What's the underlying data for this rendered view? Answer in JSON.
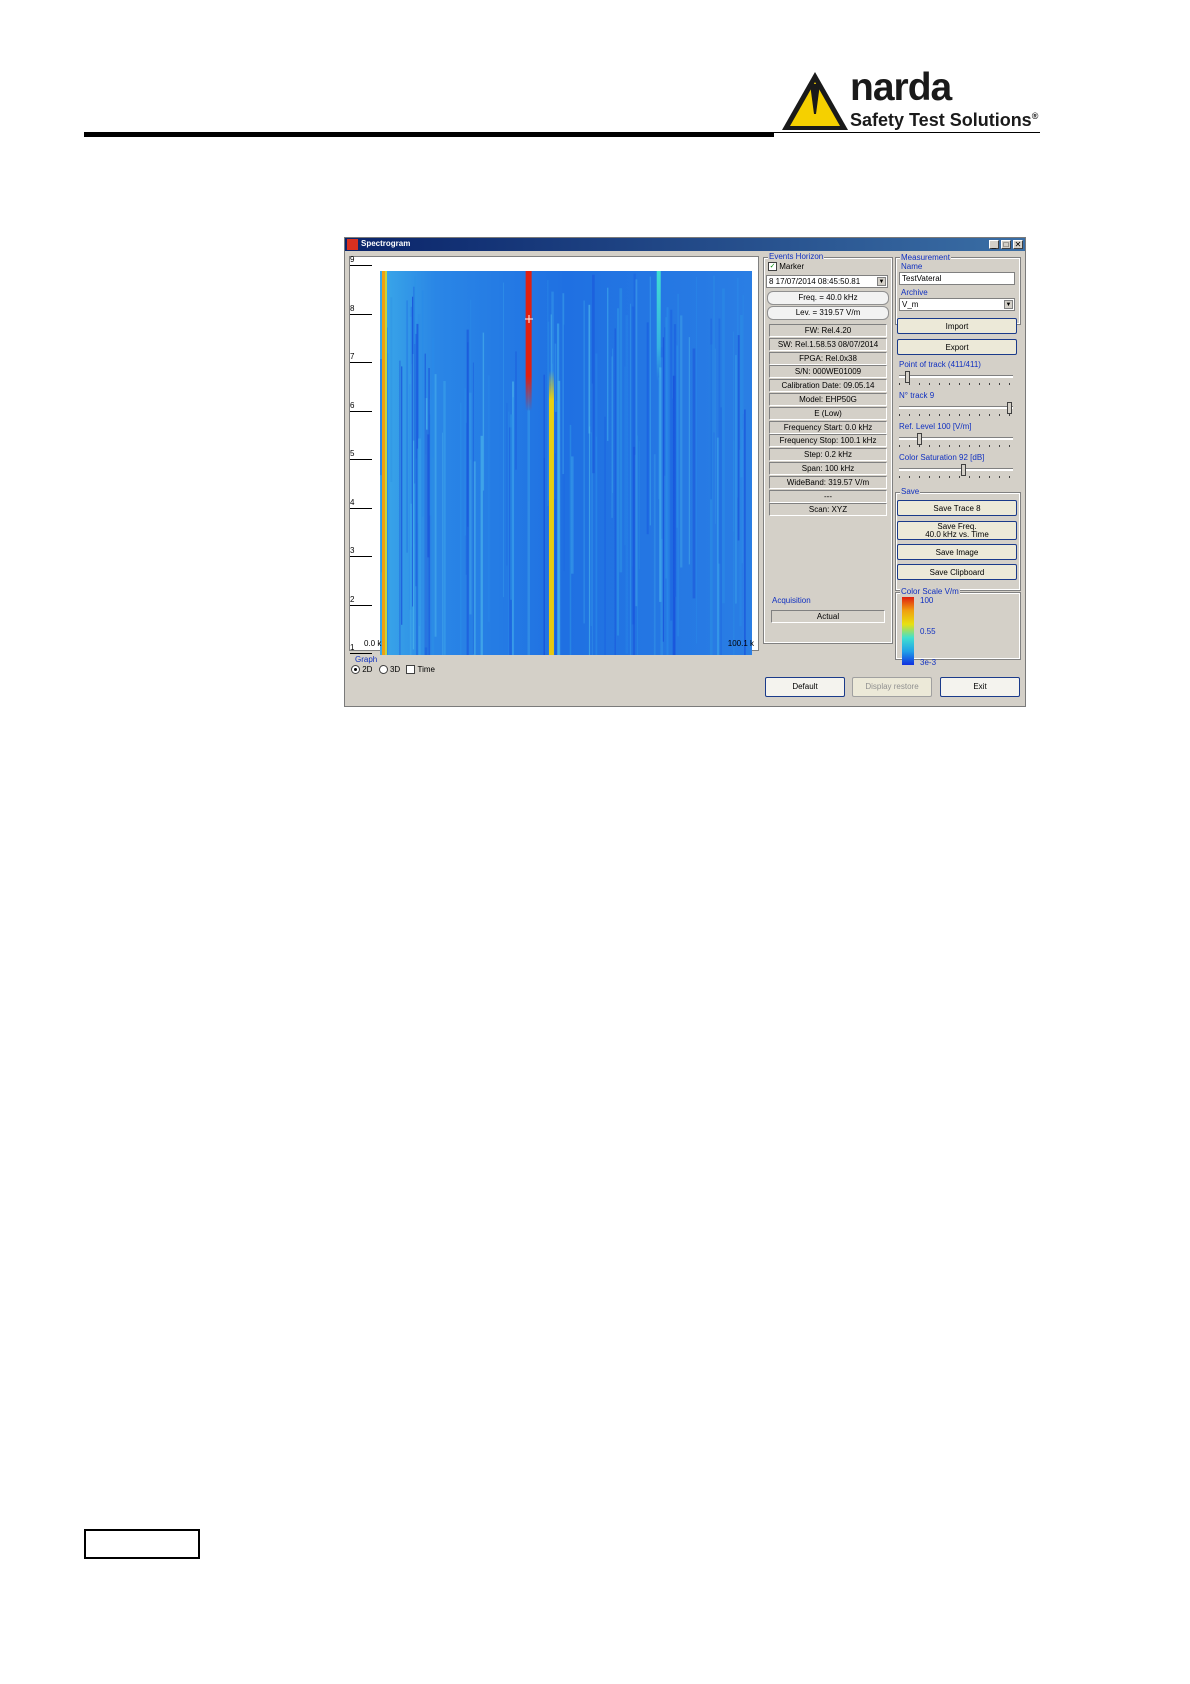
{
  "brand": {
    "name": "narda",
    "tagline": "Safety Test Solutions",
    "reg": "®"
  },
  "window": {
    "title": "Spectrogram",
    "min_glyph": "_",
    "max_glyph": "□",
    "close_glyph": "✕"
  },
  "chart_data": {
    "type": "heatmap",
    "y_ticks": [
      "9",
      "8",
      "7",
      "6",
      "5",
      "4",
      "3",
      "2",
      "1"
    ],
    "x_ticks": [
      "0.0 k",
      "100.1 k"
    ],
    "colormap": [
      "#1030e0",
      "#1060f0",
      "#20a0e8",
      "#40c8e0",
      "#e8e010",
      "#f0a010",
      "#e02010"
    ],
    "features": [
      {
        "label": "strong signal at start of band",
        "x": 0.0,
        "color": "#f0a010"
      },
      {
        "label": "red burst near marker",
        "x": 40.0,
        "color": "#e02010"
      },
      {
        "label": "yellow continuous line",
        "x": 46.0,
        "color": "#e8d010"
      },
      {
        "label": "cyan faint line",
        "x": 75.0,
        "color": "#40e0d0"
      }
    ]
  },
  "graph": {
    "label": "Graph",
    "opt2d": "2D",
    "opt3d": "3D",
    "time": "Time"
  },
  "events": {
    "label": "Events Horizon",
    "marker": "Marker",
    "dropdown": "8  17/07/2014 08:45:50.81",
    "freq": "Freq. = 40.0 kHz",
    "lev": "Lev. = 319.57 V/m"
  },
  "info": [
    "FW: Rel.4.20",
    "SW: Rel.1.58.53 08/07/2014",
    "FPGA: Rel.0x38",
    "S/N: 000WE01009",
    "Calibration Date: 09.05.14",
    "Model: EHP50G",
    "E (Low)",
    "Frequency Start: 0.0 kHz",
    "Frequency Stop: 100.1 kHz",
    "Step: 0.2 kHz",
    "Span: 100 kHz",
    "WideBand: 319.57 V/m",
    "---",
    "Scan: XYZ"
  ],
  "acquisition": {
    "label": "Acquisition",
    "value": "Actual"
  },
  "measurement": {
    "label": "Measurement",
    "name_label": "Name",
    "name_value": "TestVateral",
    "archive_label": "Archive",
    "archive_value": "V_m",
    "import": "Import",
    "export": "Export"
  },
  "sliders": {
    "point": "Point of track (411/411)",
    "ntrack": "N° track 9",
    "reflevel": "Ref. Level 100 [V/m]",
    "colorsat": "Color Saturation 92 [dB]"
  },
  "save": {
    "label": "Save",
    "trace": "Save Trace 8",
    "freq1": "Save Freq.",
    "freq2": "40.0 kHz vs. Time",
    "image": "Save Image",
    "clipboard": "Save Clipboard"
  },
  "colorscale": {
    "label": "Color Scale V/m",
    "max": "100",
    "mid": "0.55",
    "min": "3e-3"
  },
  "bottom": {
    "default": "Default",
    "display_restore": "Display restore",
    "exit": "Exit"
  }
}
